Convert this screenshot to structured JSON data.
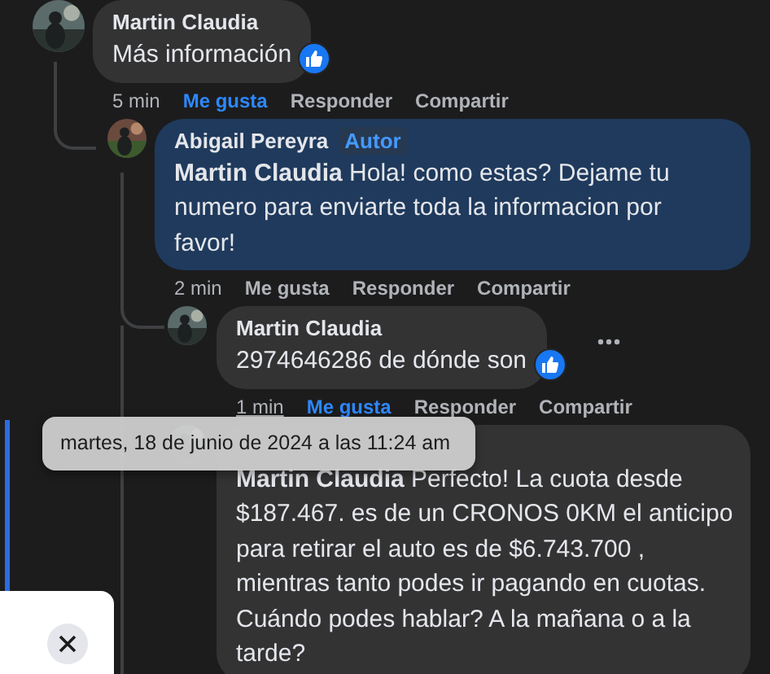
{
  "comments": [
    {
      "author": "Martin Claudia",
      "text": "Más información",
      "highlighted": false,
      "reaction": true,
      "actions": [
        {
          "label": "5 min",
          "kind": "time",
          "hovered": false
        },
        {
          "label": "Me gusta",
          "kind": "like",
          "selected": true
        },
        {
          "label": "Responder",
          "kind": "reply"
        },
        {
          "label": "Compartir",
          "kind": "share"
        }
      ],
      "replies": [
        {
          "author": "Abigail Pereyra",
          "badge": "Autor",
          "text": "**Martin Claudia** Hola! como estas? Dejame tu numero para enviarte toda la informacion por favor!",
          "highlighted": true,
          "actions": [
            {
              "label": "2 min",
              "kind": "time",
              "hovered": false
            },
            {
              "label": "Me gusta",
              "kind": "like",
              "selected": false
            },
            {
              "label": "Responder",
              "kind": "reply"
            },
            {
              "label": "Compartir",
              "kind": "share"
            }
          ],
          "replies": [
            {
              "author": "Martin Claudia",
              "text": "2974646286 de dónde son",
              "highlighted": false,
              "reaction": true,
              "more_options": true,
              "actions": [
                {
                  "label": "1 min",
                  "kind": "time",
                  "hovered": true
                },
                {
                  "label": "Me gusta",
                  "kind": "like",
                  "selected": true
                },
                {
                  "label": "Responder",
                  "kind": "reply"
                },
                {
                  "label": "Compartir",
                  "kind": "share"
                }
              ]
            },
            {
              "text": "**Martin Claudia** Perfecto! La cuota desde $187.467. es de un CRONOS 0KM el anticipo para retirar el auto es de $6.743.700 , mientras tanto podes ir pagando en cuotas. Cuándo podes hablar? A la mañana o a la tarde?",
              "highlighted": false
            }
          ]
        }
      ]
    }
  ],
  "tooltip": {
    "text": "martes, 18 de junio de 2024 a las 11:24 am"
  },
  "side_panel": {
    "close_button": true
  }
}
